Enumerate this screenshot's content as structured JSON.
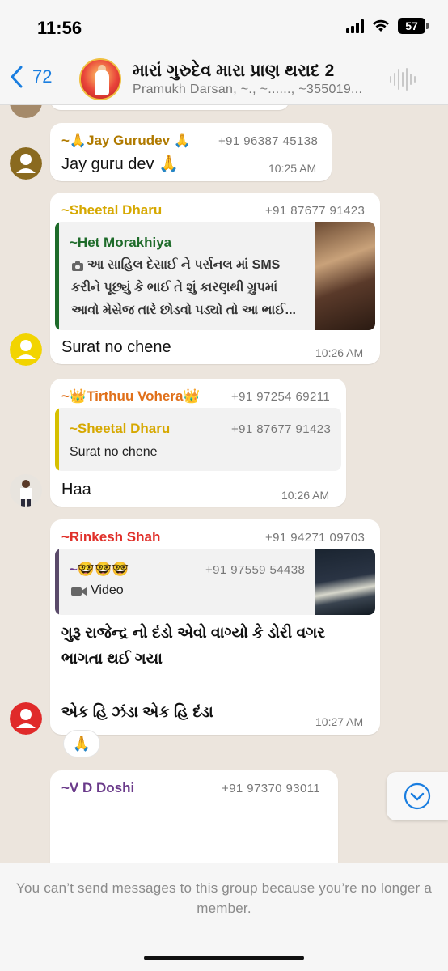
{
  "status_bar": {
    "time": "11:56",
    "battery": "57"
  },
  "header": {
    "back_count": "72",
    "title": "મારાં ગુરુદેવ મારા પ્રાણ થરાદ 2",
    "subtitle": "Pramukh Darsan, ~., ~......, ~355019..."
  },
  "messages": [
    {
      "sender": "~🙏Jay Gurudev 🙏",
      "phone": "+91 96387 45138",
      "text": "Jay guru dev 🙏",
      "time": "10:25 AM",
      "sender_color": "#b07a00"
    },
    {
      "sender": "~Sheetal Dharu",
      "phone": "+91 87677 91423",
      "quote": {
        "sender": "~Het Morakhiya",
        "lines": [
          "આ સાહિલ દેસાઈ ને પર્સનલ માં  SMS",
          "કરીને પૂછ્યું કે ભાઈ તે શું કારણથી ગ્રુપમાં",
          "આવો મેસેજ તારે છોડવો પડ્યો તો આ ભાઈ..."
        ]
      },
      "text": "Surat no chene",
      "time": "10:26 AM",
      "sender_color": "#d6a800"
    },
    {
      "sender": "~👑Tirthuu Vohera👑",
      "phone": "+91 97254 69211",
      "quote": {
        "sender": "~Sheetal Dharu",
        "phone": "+91 87677 91423",
        "text": "Surat no chene"
      },
      "text": "Haa",
      "time": "10:26 AM",
      "sender_color": "#e0701a"
    },
    {
      "sender": "~Rinkesh Shah",
      "phone": "+91 94271 09703",
      "quote": {
        "sender": "~🤓🤓🤓",
        "phone": "+91 97559 54438",
        "text": "Video"
      },
      "lines": [
        "ગુરૂ રાજેન્દ્ર નો દંડો એવો વાગ્યો કે ડોરી વગર",
        "ભાગતા થઈ ગયા",
        "",
        "એક હિ ઝંડા એક હિ દંડા"
      ],
      "time": "10:27 AM",
      "reaction": "🙏",
      "sender_color": "#e0302a"
    },
    {
      "sender": "~V D Doshi",
      "phone": "+91 97370 93011",
      "sender_color": "#6a3a8a"
    }
  ],
  "footer": {
    "notice": "You can’t send messages to this group because you’re no longer a member."
  }
}
